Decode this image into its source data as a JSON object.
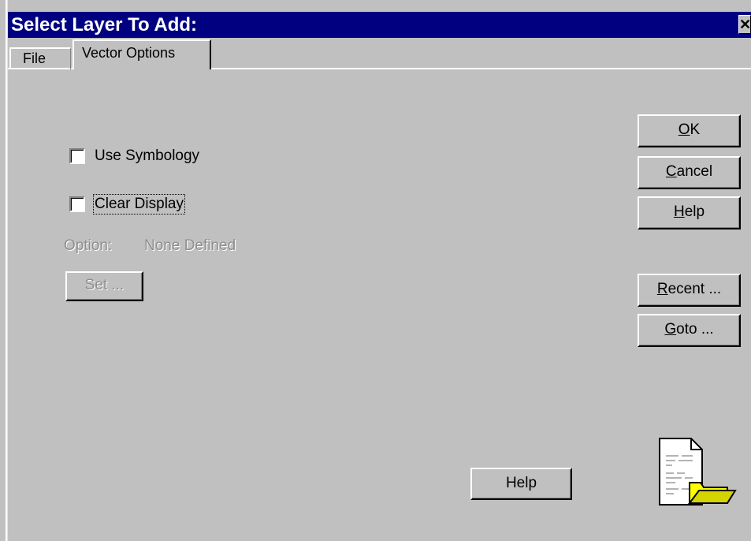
{
  "window": {
    "title": "Select Layer To Add:",
    "close_glyph": "✕"
  },
  "tabs": [
    {
      "label": "File",
      "active": false
    },
    {
      "label": "Vector Options",
      "active": true
    }
  ],
  "options": {
    "use_symbology_label": "Use Symbology",
    "use_symbology_checked": false,
    "clear_display_label": "Clear Display",
    "clear_display_checked": false,
    "option_label": "Option:",
    "option_value": "None Defined",
    "set_button_label": "Set ..."
  },
  "buttons": {
    "ok": {
      "mnemonic": "O",
      "rest": "K"
    },
    "cancel": {
      "mnemonic": "C",
      "rest": "ancel"
    },
    "help": {
      "mnemonic": "H",
      "rest": "elp"
    },
    "recent": {
      "mnemonic": "R",
      "rest": "ecent ..."
    },
    "goto": {
      "mnemonic": "G",
      "rest": "oto ..."
    },
    "bottom_help_label": "Help"
  },
  "icons": {
    "file_open": "document-folder-icon"
  },
  "colors": {
    "titlebar": "#000080",
    "face": "#c0c0c0",
    "folder": "#ffff00",
    "disabled_text": "#8e8e8e"
  }
}
